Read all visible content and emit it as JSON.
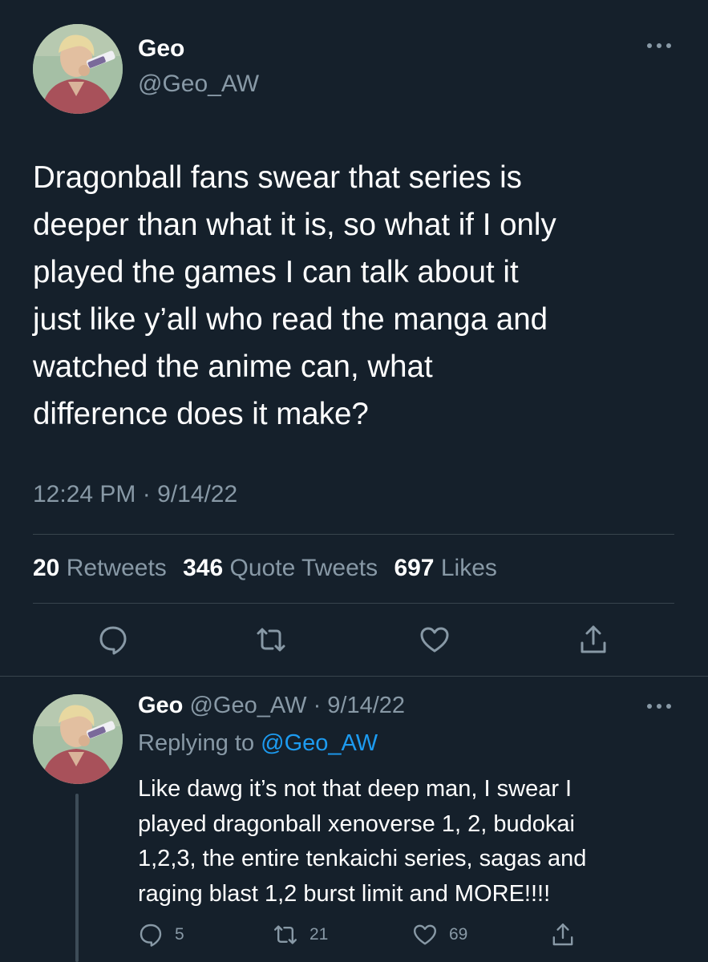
{
  "main_tweet": {
    "author_name": "Geo",
    "author_handle": "@Geo_AW",
    "text": "Dragonball fans swear that series is\ndeeper than what it is, so what if I only\nplayed the games I can talk about it\njust like y’all who read the manga and\nwatched the anime can, what\ndifference does it make?",
    "timestamp": "12:24 PM · 9/14/22",
    "stats": {
      "retweets_count": "20",
      "retweets_label": "Retweets",
      "quotes_count": "346",
      "quotes_label": "Quote Tweets",
      "likes_count": "697",
      "likes_label": "Likes"
    },
    "actions": [
      "reply-icon",
      "retweet-icon",
      "like-icon",
      "share-icon"
    ]
  },
  "reply_tweet": {
    "author_name": "Geo",
    "author_handle": "@Geo_AW",
    "dot_date": "· 9/14/22",
    "replying_label": "Replying to",
    "replying_to": "@Geo_AW",
    "text": "Like dawg it’s not that deep man, I swear I\nplayed dragonball xenoverse 1, 2, budokai\n1,2,3, the entire tenkaichi series, sagas and\nraging blast 1,2 burst limit and MORE!!!!",
    "reply_count": "5",
    "retweet_count": "21",
    "like_count": "69"
  },
  "colors": {
    "background": "#15202b",
    "primary_text": "#ffffff",
    "secondary_text": "#8899a6",
    "link": "#1d9bf0",
    "divider": "#38444d"
  }
}
